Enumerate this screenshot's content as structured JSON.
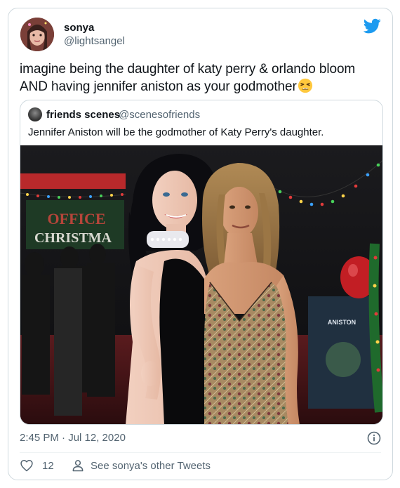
{
  "author": {
    "name": "sonya",
    "handle": "@lightsangel"
  },
  "tweet": {
    "text": "imagine being the daughter of katy perry & orlando bloom AND having jennifer aniston as your godmother",
    "emoji": "tired-face-emoji"
  },
  "quoted": {
    "name": "friends scenes",
    "handle": "@scenesofriends",
    "text": "Jennifer Aniston will be the godmother of Katy Perry's daughter.",
    "photo_sign_line1": "OFFICE",
    "photo_sign_line2": "CHRISTMA",
    "photo_poster": "ANISTON"
  },
  "meta": {
    "timestamp": "2:45 PM · Jul 12, 2020"
  },
  "actions": {
    "like_count": "12",
    "profile_link": "See sonya's other Tweets"
  },
  "colors": {
    "twitter_blue": "#1d9bf0",
    "text": "#0f1419",
    "secondary": "#536471",
    "border": "#cfd9de"
  }
}
